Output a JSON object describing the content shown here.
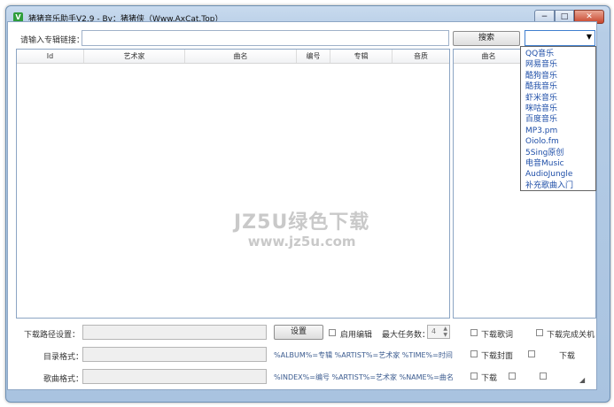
{
  "window": {
    "title": "猪猪音乐助手V2.9 - By：猪猪侠（Www.AxCat.Top）",
    "icon": "app-icon",
    "app_icon_letter": "V",
    "minimize": "−",
    "maximize": "□",
    "close": "✕"
  },
  "search": {
    "label": "请输入专辑链接：",
    "value": "",
    "button_label": "搜索",
    "source_selected": ""
  },
  "main_list": {
    "columns": [
      "Id",
      "艺术家",
      "曲名",
      "编号",
      "专辑",
      "音质"
    ]
  },
  "side_list": {
    "columns": [
      "曲名"
    ]
  },
  "source_options": [
    "QQ音乐",
    "网易音乐",
    "酷狗音乐",
    "酷我音乐",
    "虾米音乐",
    "咪咕音乐",
    "百度音乐",
    "MP3.pm",
    "Oiolo.fm",
    "5Sing原创",
    "电音Music",
    "AudioJungle",
    "补充歌曲入门"
  ],
  "download": {
    "path_label": "下载路径设置：",
    "path_value": "",
    "set_button": "设置",
    "enable_edit_label": "启用编辑",
    "max_tasks_label": "最大任务数：",
    "max_tasks_value": "4",
    "download_lyrics_label": "下载歌词",
    "shutdown_label": "下载完成关机"
  },
  "format": {
    "dir_label": "目录格式：",
    "dir_hint": "%ALBUM%=专辑 %ARTIST%=艺术家 %TIME%=时间",
    "song_label": "歌曲格式：",
    "song_hint": "%INDEX%=编号 %ARTIST%=艺术家 %NAME%=曲名",
    "opt1_label": "下载封面",
    "opt2_label": "下载",
    "opt3_label": "下载"
  },
  "watermark": {
    "line1": "JZ5U绿色下载",
    "line2": "www.jz5u.com"
  }
}
